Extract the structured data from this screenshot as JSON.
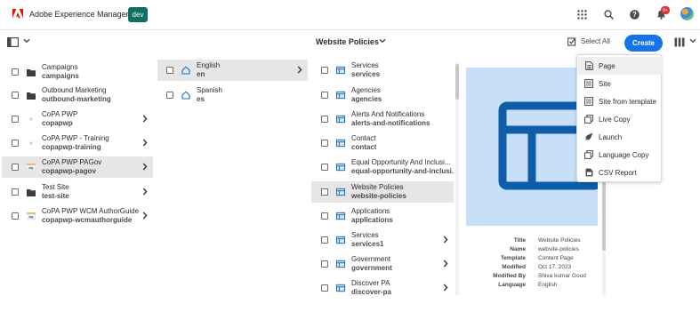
{
  "header": {
    "app_title": "Adobe Experience Manager",
    "env_badge": "dev",
    "notification_count": "9+"
  },
  "toolbar": {
    "view_title": "Website Policies",
    "select_all_label": "Select All",
    "create_label": "Create"
  },
  "column1": [
    {
      "title": "Campaigns",
      "subtitle": "campaigns",
      "icon": "folder-icon",
      "has_children": false
    },
    {
      "title": "Outbound Marketing",
      "subtitle": "outbound-marketing",
      "icon": "folder-icon",
      "has_children": false
    },
    {
      "title": "CoPA PWP",
      "subtitle": "copapwp",
      "icon": "page-dot-icon",
      "has_children": true
    },
    {
      "title": "CoPA PWP - Training",
      "subtitle": "copapwp-training",
      "icon": "page-dot-icon",
      "has_children": true
    },
    {
      "title": "CoPA PWP PAGov",
      "subtitle": "copapwp-pagov",
      "icon": "pa-thumbnail-icon",
      "has_children": true,
      "selected": true
    },
    {
      "title": "Test Site",
      "subtitle": "test-site",
      "icon": "folder-icon",
      "has_children": true
    },
    {
      "title": "CoPA PWP WCM AuthorGuide",
      "subtitle": "copapwp-wcmauthorguide",
      "icon": "pa-thumbnail-icon",
      "has_children": true
    }
  ],
  "column2": [
    {
      "title": "English",
      "subtitle": "en",
      "icon": "home-icon",
      "has_children": true,
      "selected": true
    },
    {
      "title": "Spanish",
      "subtitle": "es",
      "icon": "home-icon",
      "has_children": false
    }
  ],
  "column3": [
    {
      "title": "Services",
      "subtitle": "services",
      "has_children": false
    },
    {
      "title": "Agencies",
      "subtitle": "agencies",
      "has_children": false
    },
    {
      "title": "Alerts And Notifications",
      "subtitle": "alerts-and-notifications",
      "has_children": false
    },
    {
      "title": "Contact",
      "subtitle": "contact",
      "has_children": false
    },
    {
      "title": "Equal Opportunity And Inclusi...",
      "subtitle": "equal-opportunity-and-inclusi...",
      "has_children": false
    },
    {
      "title": "Website Policies",
      "subtitle": "website-policies",
      "has_children": false,
      "selected": true
    },
    {
      "title": "Applications",
      "subtitle": "applications",
      "has_children": false
    },
    {
      "title": "Services",
      "subtitle": "services1",
      "has_children": true
    },
    {
      "title": "Government",
      "subtitle": "government",
      "has_children": true
    },
    {
      "title": "Discover PA",
      "subtitle": "discover-pa",
      "has_children": true
    }
  ],
  "preview": {
    "meta": [
      {
        "key": "Title",
        "value": "Website Policies"
      },
      {
        "key": "Name",
        "value": "website-policies"
      },
      {
        "key": "Template",
        "value": "Content Page"
      },
      {
        "key": "Modified",
        "value": "Oct 17, 2023"
      },
      {
        "key": "Modified By",
        "value": "Shiva kumar Goud"
      },
      {
        "key": "Language",
        "value": "English"
      }
    ]
  },
  "create_menu": [
    {
      "label": "Page",
      "icon": "page-icon",
      "active": true
    },
    {
      "label": "Site",
      "icon": "site-icon"
    },
    {
      "label": "Site from template",
      "icon": "site-template-icon"
    },
    {
      "label": "Live Copy",
      "icon": "live-copy-icon"
    },
    {
      "label": "Launch",
      "icon": "launch-icon"
    },
    {
      "label": "Language Copy",
      "icon": "language-copy-icon"
    },
    {
      "label": "CSV Report",
      "icon": "csv-report-icon"
    }
  ],
  "colors": {
    "accent": "#1473e6",
    "env_badge": "#0d7060",
    "adobe_red": "#eb1000",
    "preview_bg": "#c8dff8",
    "page_icon_blue": "#1e6fb8"
  }
}
